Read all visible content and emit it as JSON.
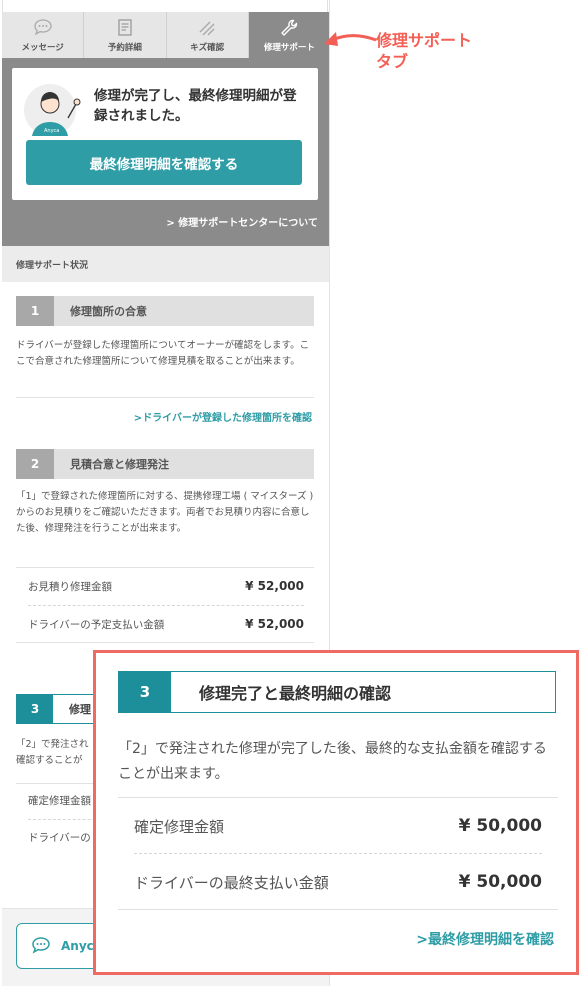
{
  "tabs": [
    {
      "label": "メッセージ",
      "icon": "chat-bubble-icon"
    },
    {
      "label": "予約詳細",
      "icon": "document-icon"
    },
    {
      "label": "キズ確認",
      "icon": "scratch-icon"
    },
    {
      "label": "修理サポート",
      "icon": "wrench-icon"
    }
  ],
  "hero": {
    "avatar_text": "Anyca",
    "message": "修理が完了し、最終修理明細が登録されました。",
    "button": "最終修理明細を確認する",
    "link": "修理サポートセンターについて"
  },
  "section_label": "修理サポート状況",
  "step1": {
    "num": "1",
    "title": "修理箇所の合意",
    "desc": "ドライバーが登録した修理箇所についてオーナーが確認をします。ここで合意された修理箇所について修理見積を取ることが出来ます。",
    "link": "ドライバーが登録した修理箇所を確認"
  },
  "step2": {
    "num": "2",
    "title": "見積合意と修理発注",
    "desc": "「1」で登録された修理箇所に対する、提携修理工場 ( マイスターズ ) からのお見積りをご確認いただきます。両者でお見積り内容に合意した後、修理発注を行うことが出来ます。",
    "rows": [
      {
        "label": "お見積り修理金額",
        "value": "¥ 52,000"
      },
      {
        "label": "ドライバーの予定支払い金額",
        "value": "¥ 52,000"
      }
    ]
  },
  "step3_small": {
    "num": "3",
    "title": "修理",
    "desc1": "「2」で発注され",
    "desc2": "確認することが",
    "row1": "確定修理金額",
    "row2": "ドライバーの"
  },
  "bottom": {
    "chat_label": "Anyc"
  },
  "annotation": {
    "line1": "修理サポート",
    "line2": "タブ"
  },
  "zoom": {
    "num": "3",
    "title": "修理完了と最終明細の確認",
    "desc": "「2」で発注された修理が完了した後、最終的な支払金額を確認することが出来ます。",
    "rows": [
      {
        "label": "確定修理金額",
        "value": "¥ 50,000"
      },
      {
        "label": "ドライバーの最終支払い金額",
        "value": "¥ 50,000"
      }
    ],
    "link": "最終修理明細を確認"
  },
  "colors": {
    "accent": "#2e9da6",
    "step_active": "#1c8f9b",
    "annotation": "#f35f55",
    "tab_active": "#8b8b8b"
  }
}
